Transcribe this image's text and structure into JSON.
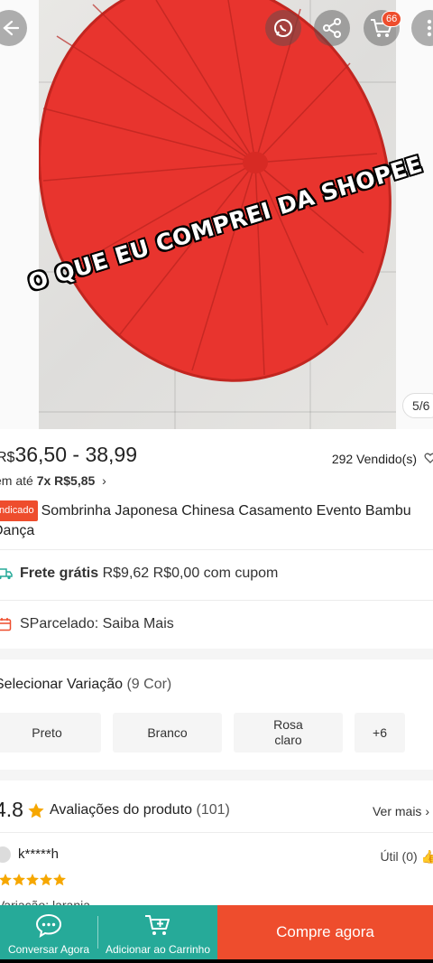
{
  "header": {
    "cart_count": "66",
    "image_counter": "5/6"
  },
  "overlay": {
    "text": "O QUE EU COMPREI DA SHOPEE"
  },
  "product": {
    "price_currency": "R$",
    "price_range": "36,50 - 38,99",
    "sold": "292 Vendido(s)",
    "installment_prefix": "em até ",
    "installment_value": "7x R$5,85",
    "tag": "Indicado",
    "title": "Sombrinha Japonesa Chinesa Casamento Evento Bambu Dança"
  },
  "shipping": {
    "label": "Frete grátis",
    "text": "R$9,62 R$0,00 com cupom"
  },
  "parcelado": {
    "text": "SParcelado: Saiba Mais"
  },
  "variation": {
    "label": "Selecionar Variação",
    "count": "(9 Cor)",
    "options": [
      "Preto",
      "Branco",
      "Rosa claro",
      "+6"
    ]
  },
  "ratings": {
    "score": "4.8",
    "label": "Avaliações do produto",
    "count": "(101)",
    "see_more": "Ver mais"
  },
  "review": {
    "user": "k*****h",
    "useful": "Útil (0)",
    "stars": 5,
    "partial_text": "Variação: laranja"
  },
  "bottom_bar": {
    "chat": "Conversar Agora",
    "add_cart": "Adicionar ao Carrinho",
    "buy": "Compre agora"
  },
  "colors": {
    "shopee_orange": "#ee4d2d",
    "teal": "#26aa99",
    "umbrella_red": "#e8342e",
    "star": "#f6a700"
  }
}
